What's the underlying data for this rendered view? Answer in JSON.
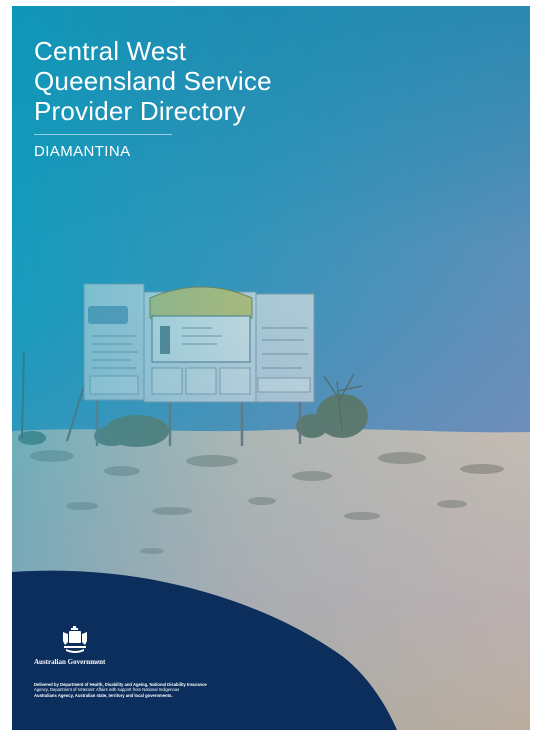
{
  "cover": {
    "title_lines": [
      "Central West",
      "Queensland Service",
      "Provider Directory"
    ],
    "subtitle": "DIAMANTINA",
    "colors": {
      "navy": "#0b2e5c",
      "teal": "#1aa6c4",
      "sand": "#cfc2a9"
    }
  },
  "footer": {
    "logo_icon": "australian-government-crest-icon",
    "government_name": "Australian Government",
    "credits": [
      "Delivered by Department of Health, Disability and Ageing, National Disability Insurance",
      "Agency, Department of Veterans' Affairs with support from National Indigenous",
      "Australians Agency, Australian state, territory and local governments."
    ]
  }
}
